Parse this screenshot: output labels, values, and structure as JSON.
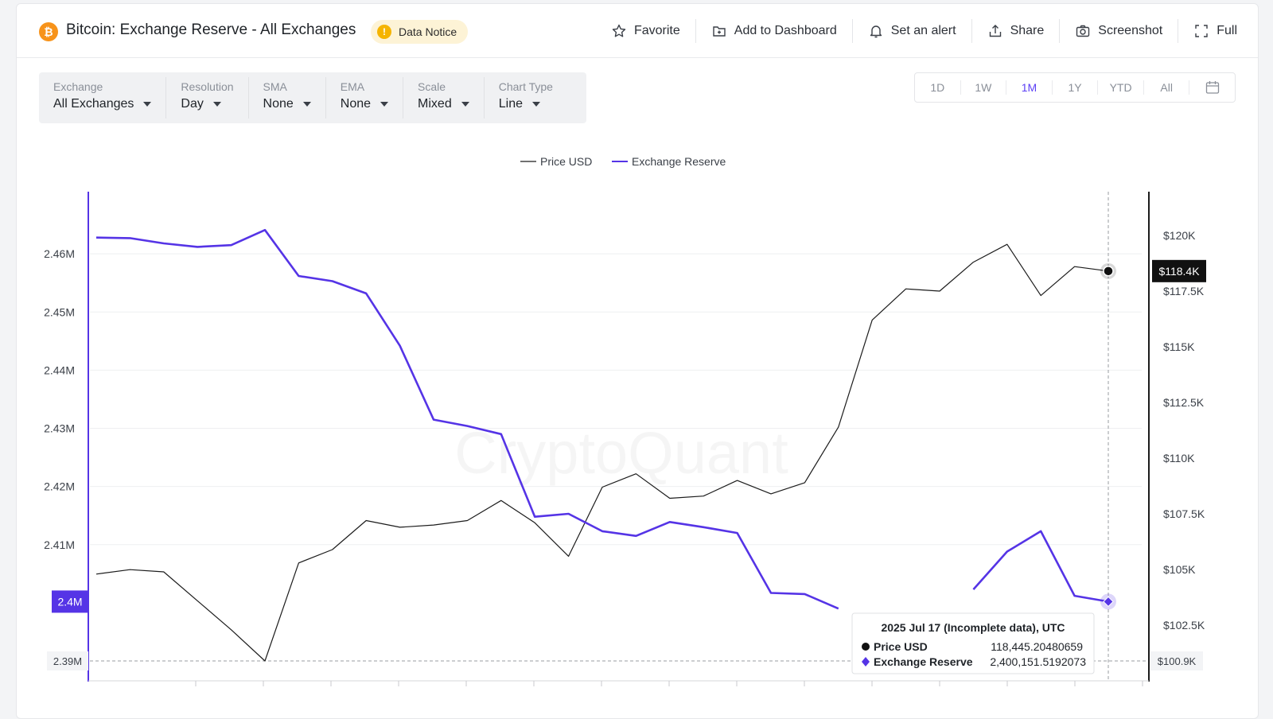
{
  "header": {
    "logo_glyph": "₿",
    "title": "Bitcoin: Exchange Reserve - All Exchanges",
    "notice_icon": "!",
    "notice": "Data Notice",
    "actions": [
      {
        "label": "Favorite",
        "icon": "star-icon"
      },
      {
        "label": "Add to Dashboard",
        "icon": "dashboard-add-icon"
      },
      {
        "label": "Set an alert",
        "icon": "bell-icon"
      },
      {
        "label": "Share",
        "icon": "share-icon"
      },
      {
        "label": "Screenshot",
        "icon": "camera-icon"
      },
      {
        "label": "Full",
        "icon": "fullscreen-icon"
      }
    ]
  },
  "controls": [
    {
      "label": "Exchange",
      "value": "All Exchanges"
    },
    {
      "label": "Resolution",
      "value": "Day"
    },
    {
      "label": "SMA",
      "value": "None"
    },
    {
      "label": "EMA",
      "value": "None"
    },
    {
      "label": "Scale",
      "value": "Mixed"
    },
    {
      "label": "Chart Type",
      "value": "Line"
    }
  ],
  "ranges": {
    "options": [
      "1D",
      "1W",
      "1M",
      "1Y",
      "YTD",
      "All"
    ],
    "active": "1M",
    "calendar_icon": "calendar-icon"
  },
  "colors": {
    "accent": "#5b3ff5",
    "price": "#1c1c1c",
    "reserve": "#5534e6"
  },
  "chart_data": {
    "type": "line",
    "watermark": "CryptoQuant",
    "legend": [
      "Price USD",
      "Exchange Reserve"
    ],
    "legend_position": "top-center",
    "left_axis": {
      "ticks": [
        "2.46M",
        "2.45M",
        "2.44M",
        "2.43M",
        "2.42M",
        "2.41M"
      ],
      "range": [
        2.39,
        2.467
      ],
      "unit": "M"
    },
    "right_axis": {
      "ticks": [
        "$120K",
        "$117.5K",
        "$115K",
        "$112.5K",
        "$110K",
        "$107.5K",
        "$105K",
        "$102.5K"
      ],
      "range": [
        100.9,
        121.0
      ],
      "unit": "K USD"
    },
    "series": [
      {
        "name": "Exchange Reserve",
        "axis": "left",
        "values": [
          2.4628,
          2.4627,
          2.4618,
          2.4612,
          2.4615,
          2.4641,
          2.4562,
          2.4553,
          2.4532,
          2.4442,
          2.4315,
          2.4304,
          2.429,
          2.4148,
          2.4153,
          2.4123,
          2.4115,
          2.4139,
          2.413,
          2.412,
          2.4017,
          2.4015,
          2.399,
          null,
          null,
          null,
          2.4023,
          2.4088,
          2.4123,
          2.4012,
          2.4002
        ]
      },
      {
        "name": "Price USD",
        "axis": "right",
        "values": [
          104.8,
          105.0,
          104.9,
          103.6,
          102.3,
          100.9,
          105.3,
          105.9,
          107.2,
          106.9,
          107.0,
          107.2,
          108.1,
          107.1,
          105.6,
          108.7,
          109.3,
          108.2,
          108.3,
          109.0,
          108.4,
          108.9,
          111.4,
          116.2,
          117.6,
          117.5,
          118.8,
          119.6,
          117.3,
          118.6,
          118.4
        ]
      }
    ],
    "current_values": {
      "price_label": "$118.4K",
      "reserve_label": "2.4M",
      "reserve_min_label": "2.39M",
      "price_min_label": "$100.9K"
    },
    "tooltip": {
      "title": "2025 Jul 17 (Incomplete data), UTC",
      "rows": [
        {
          "marker": "●",
          "label": "Price USD",
          "value": "118,445.20480659"
        },
        {
          "marker": "◆",
          "label": "Exchange Reserve",
          "value": "2,400,151.5192073"
        }
      ]
    }
  }
}
